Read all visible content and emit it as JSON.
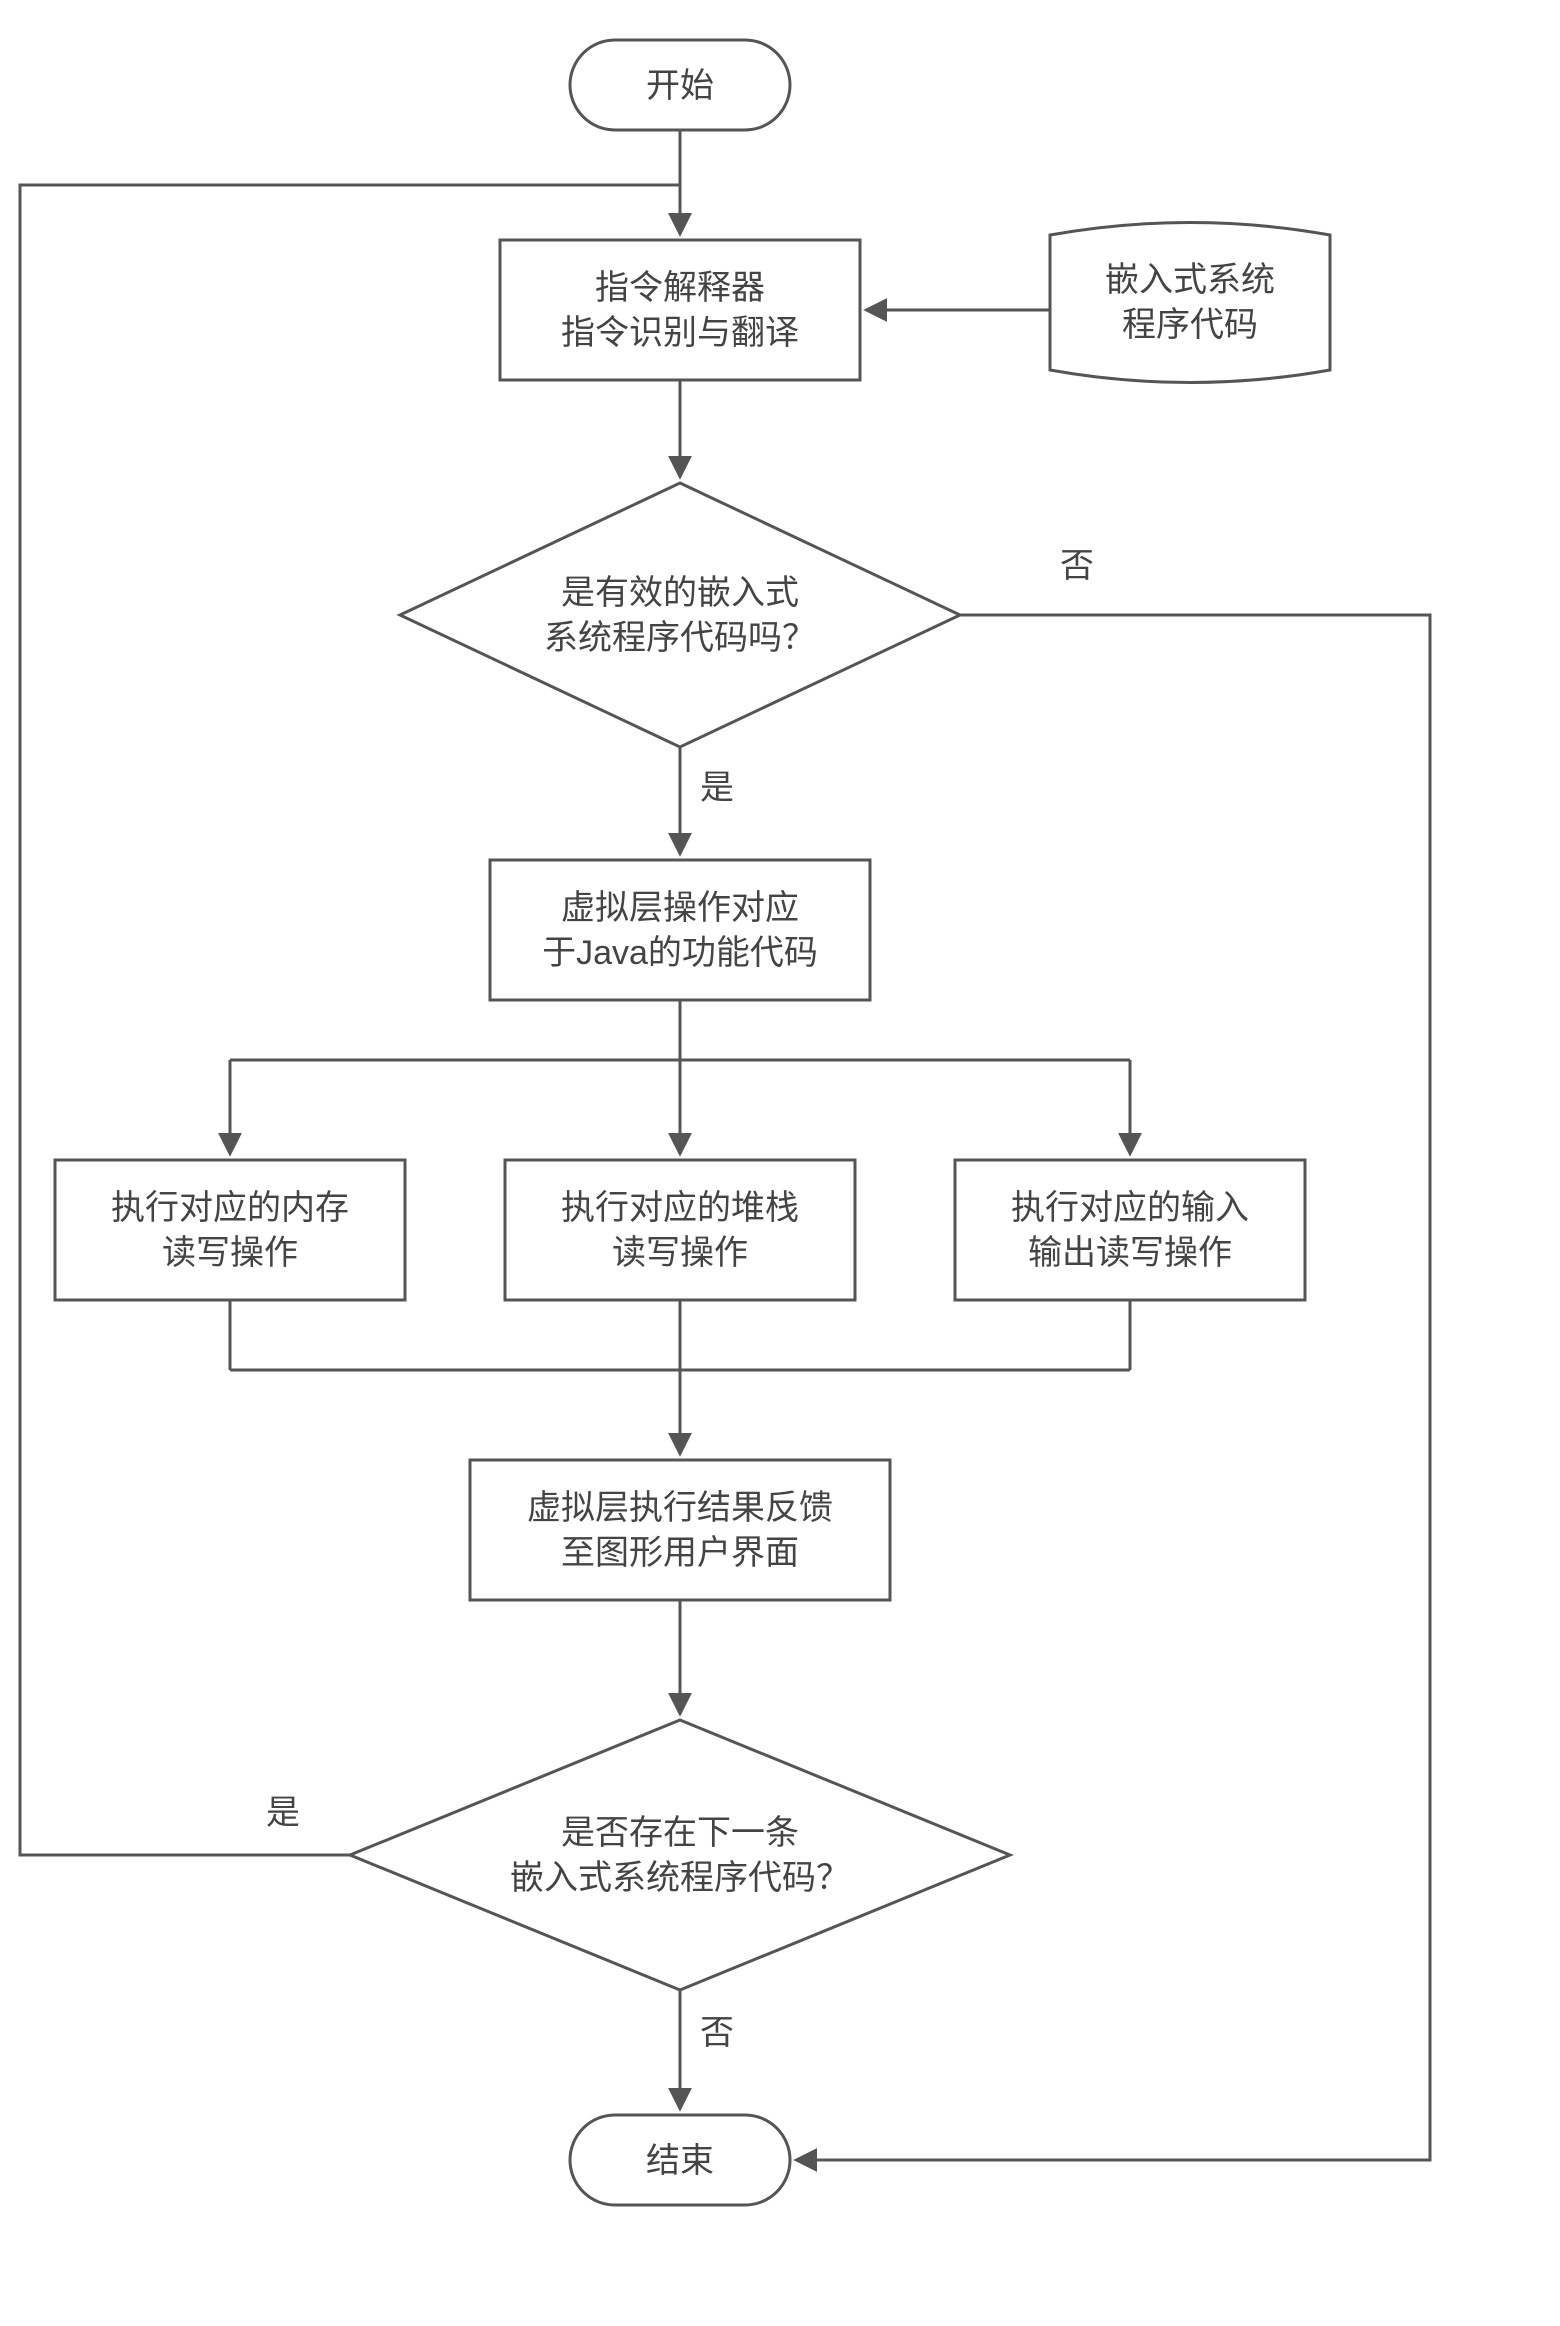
{
  "start": "开始",
  "end": "结束",
  "interpreter_l1": "指令解释器",
  "interpreter_l2": "指令识别与翻译",
  "doc_l1": "嵌入式系统",
  "doc_l2": "程序代码",
  "dec1_l1": "是有效的嵌入式",
  "dec1_l2": "系统程序代码吗？",
  "virtual_l1": "虚拟层操作对应",
  "virtual_l2": "于Java的功能代码",
  "op_mem_l1": "执行对应的内存",
  "op_mem_l2": "读写操作",
  "op_stack_l1": "执行对应的堆栈",
  "op_stack_l2": "读写操作",
  "op_io_l1": "执行对应的输入",
  "op_io_l2": "输出读写操作",
  "feedback_l1": "虚拟层执行结果反馈",
  "feedback_l2": "至图形用户界面",
  "dec2_l1": "是否存在下一条",
  "dec2_l2": "嵌入式系统程序代码？",
  "yes": "是",
  "no": "否"
}
